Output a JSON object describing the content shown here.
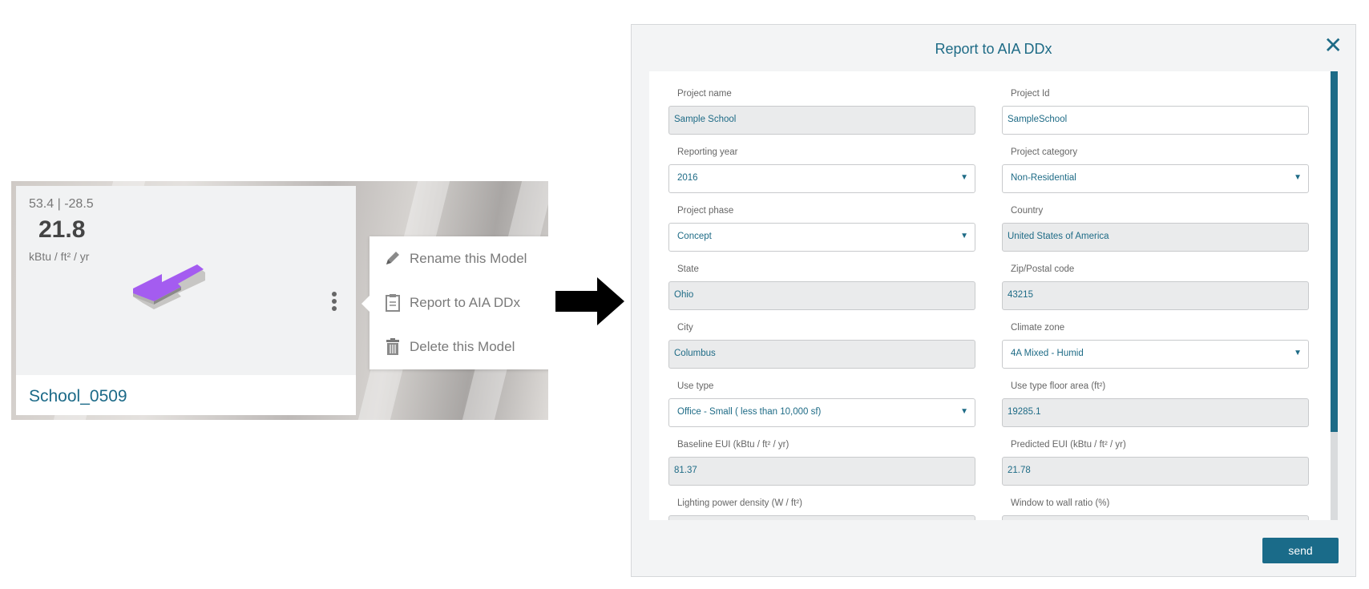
{
  "card": {
    "coords": "53.4 | -28.5",
    "eui_value": "21.8",
    "eui_unit": "kBtu / ft² / yr",
    "model_name": "School_0509",
    "menu": [
      {
        "label": "Rename this Model",
        "icon": "pencil-icon"
      },
      {
        "label": "Report to AIA DDx",
        "icon": "clipboard-icon"
      },
      {
        "label": "Delete this Model",
        "icon": "trash-icon"
      }
    ]
  },
  "modal": {
    "title": "Report to AIA DDx",
    "close_label": "✕",
    "send_label": "send",
    "fields": {
      "project_name": {
        "label": "Project name",
        "value": "Sample School"
      },
      "project_id": {
        "label": "Project Id",
        "value": "SampleSchool"
      },
      "reporting_year": {
        "label": "Reporting year",
        "value": "2016"
      },
      "project_category": {
        "label": "Project category",
        "value": "Non-Residential"
      },
      "project_phase": {
        "label": "Project phase",
        "value": "Concept"
      },
      "country": {
        "label": "Country",
        "value": "United States of America"
      },
      "state": {
        "label": "State",
        "value": "Ohio"
      },
      "zip": {
        "label": "Zip/Postal code",
        "value": "43215"
      },
      "city": {
        "label": "City",
        "value": "Columbus"
      },
      "climate_zone": {
        "label": "Climate zone",
        "value": "4A Mixed - Humid"
      },
      "use_type": {
        "label": "Use type",
        "value": "Office - Small ( less than 10,000 sf)"
      },
      "use_type_area": {
        "label": "Use type floor area (ft²)",
        "value": "19285.1"
      },
      "baseline_eui": {
        "label": "Baseline EUI (kBtu / ft² / yr)",
        "value": "81.37"
      },
      "predicted_eui": {
        "label": "Predicted EUI (kBtu / ft² / yr)",
        "value": "21.78"
      },
      "lpd": {
        "label": "Lighting power density (W / ft²)",
        "value": ""
      },
      "wwr": {
        "label": "Window to wall ratio (%)",
        "value": ""
      }
    },
    "caret": "▼"
  },
  "colors": {
    "accent": "#1e6b86",
    "model_purple": "#a45cf0"
  }
}
